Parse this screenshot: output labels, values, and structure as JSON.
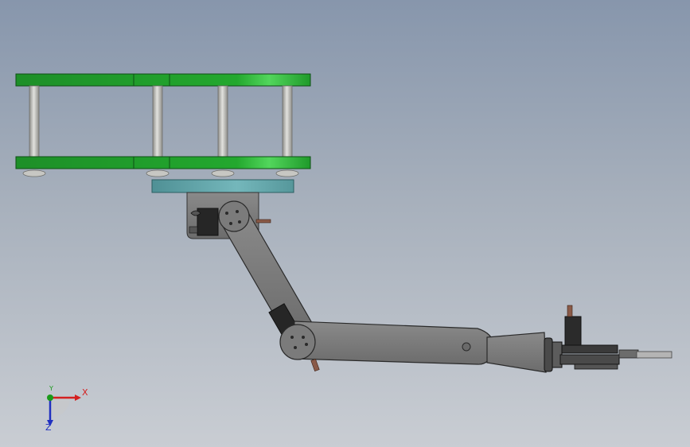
{
  "viewport": {
    "background_top": "#8796ac",
    "background_bottom": "#c9cdd3"
  },
  "model": {
    "colors": {
      "plate_green": "#1f9a2a",
      "plate_highlight": "#4fd45a",
      "standoff": "#b9b9b4",
      "base_plate": "#5fa3a7",
      "arm_gray": "#7d7d7d",
      "servo_dark": "#2a2a2a",
      "outline": "#222222"
    }
  },
  "triad": {
    "x_label": "X",
    "y_label": "Y",
    "z_label": "Z",
    "x_color": "#d42020",
    "y_color": "#1a9a1a",
    "z_color": "#2030c0"
  }
}
